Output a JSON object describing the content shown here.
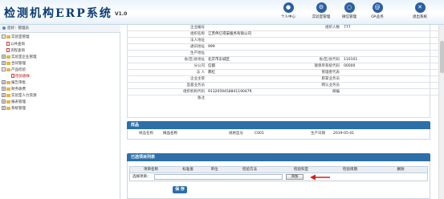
{
  "header": {
    "title": "检测机构ERP系统",
    "version": "V1.0",
    "nav": [
      {
        "label": "个人中心",
        "icon": "user-icon"
      },
      {
        "label": "实验室管理",
        "icon": "lab-icon"
      },
      {
        "label": "微信管理",
        "icon": "wechat-icon"
      },
      {
        "label": "OA业务",
        "icon": "oa-icon"
      },
      {
        "label": "退出系统",
        "icon": "logout-icon"
      }
    ]
  },
  "breadcrumb": "您好：管理员",
  "sidebar": {
    "root": "实验室管理",
    "items": [
      {
        "label": "公共查询",
        "toggle": "",
        "kind": "doc"
      },
      {
        "label": "流程查询",
        "toggle": "",
        "kind": "doc"
      },
      {
        "label": "实验室企业管理",
        "toggle": "+",
        "kind": "folder"
      },
      {
        "label": "合同管理",
        "toggle": "+",
        "kind": "folder"
      },
      {
        "label": "产品检验",
        "toggle": "-",
        "kind": "folder"
      },
      {
        "label": "检验收样",
        "toggle": "",
        "kind": "doc",
        "selected": true
      },
      {
        "label": "报告审批",
        "toggle": "+",
        "kind": "folder"
      },
      {
        "label": "财务收费",
        "toggle": "+",
        "kind": "folder"
      },
      {
        "label": "实验室人力资源",
        "toggle": "+",
        "kind": "folder"
      },
      {
        "label": "报表管理",
        "toggle": "+",
        "kind": "folder"
      },
      {
        "label": "系统管理",
        "toggle": "+",
        "kind": "folder"
      }
    ]
  },
  "company": {
    "rows": [
      {
        "l1": "企业编号",
        "v1": "",
        "l2": "组织人数",
        "v2": "777"
      },
      {
        "l1": "组织名称",
        "v1": "江苏伟亿得安服务有限公司",
        "l2": "",
        "v2": ""
      },
      {
        "l1": "法人地址",
        "v1": "",
        "l2": "",
        "v2": ""
      },
      {
        "l1": "通讯地址",
        "v1": "999",
        "l2": "",
        "v2": ""
      },
      {
        "l1": "生产地址",
        "v1": "",
        "l2": "",
        "v2": ""
      },
      {
        "l1": "省/区/县地址",
        "v1": "北京市东城区",
        "l2": "省/区/县代码",
        "v2": "110101"
      },
      {
        "l1": "分公司",
        "v1": "信都",
        "l2": "联保单系统代码",
        "v2": "00000"
      },
      {
        "l1": "法 人",
        "v1": "郝红",
        "l2": "管理者代表",
        "v2": ""
      },
      {
        "l1": "企业主管",
        "v1": "",
        "l2": "职掌业务员",
        "v2": ""
      },
      {
        "l1": "监督业务员",
        "v1": "",
        "l2": "网认业务员",
        "v2": ""
      },
      {
        "l1": "组织机构代码",
        "v1": "913205945884119047R",
        "l2": "邮编",
        "v2": ""
      },
      {
        "l1": "备注",
        "v1": "",
        "l2": "",
        "v2": ""
      }
    ]
  },
  "sample": {
    "title": "样品",
    "name_label": "样品名称",
    "name_value": "样品名称",
    "model_label": "规格型号",
    "model_value": "C001",
    "date_label": "生产日期",
    "date_value": "2019-05-01"
  },
  "items_panel": {
    "title": "已选项目列表",
    "columns": [
      "项目名称",
      "标准值",
      "单位",
      "检验方法",
      "检验科室",
      "检验周期",
      "删除"
    ],
    "select_label": "选择项目：",
    "add_label": "添加",
    "save_label": "保 存"
  },
  "colors": {
    "accent": "#2c6fa9",
    "arrow": "#d21e1e",
    "brand": "#0b3d75"
  }
}
